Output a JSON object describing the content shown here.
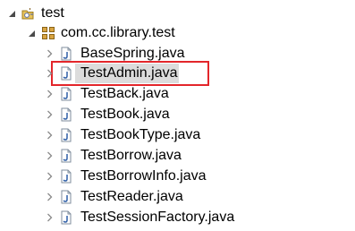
{
  "project": {
    "name": "test",
    "expanded": true,
    "icon": "java-project-icon"
  },
  "package": {
    "name": "com.cc.library.test",
    "expanded": true,
    "icon": "package-icon"
  },
  "files": [
    {
      "name": "BaseSpring.java",
      "icon": "java-file-icon",
      "selected": false,
      "highlighted": false
    },
    {
      "name": "TestAdmin.java",
      "icon": "java-file-icon",
      "selected": true,
      "highlighted": true
    },
    {
      "name": "TestBack.java",
      "icon": "java-file-icon",
      "selected": false,
      "highlighted": false
    },
    {
      "name": "TestBook.java",
      "icon": "java-file-icon",
      "selected": false,
      "highlighted": false
    },
    {
      "name": "TestBookType.java",
      "icon": "java-file-icon",
      "selected": false,
      "highlighted": false
    },
    {
      "name": "TestBorrow.java",
      "icon": "java-file-icon",
      "selected": false,
      "highlighted": false
    },
    {
      "name": "TestBorrowInfo.java",
      "icon": "java-file-icon",
      "selected": false,
      "highlighted": false
    },
    {
      "name": "TestReader.java",
      "icon": "java-file-icon",
      "selected": false,
      "highlighted": false
    },
    {
      "name": "TestSessionFactory.java",
      "icon": "java-file-icon",
      "selected": false,
      "highlighted": false
    }
  ],
  "colors": {
    "highlight_border": "#e3262b",
    "selection_background": "#dcdcdc",
    "arrow": "#9a9a9a"
  }
}
